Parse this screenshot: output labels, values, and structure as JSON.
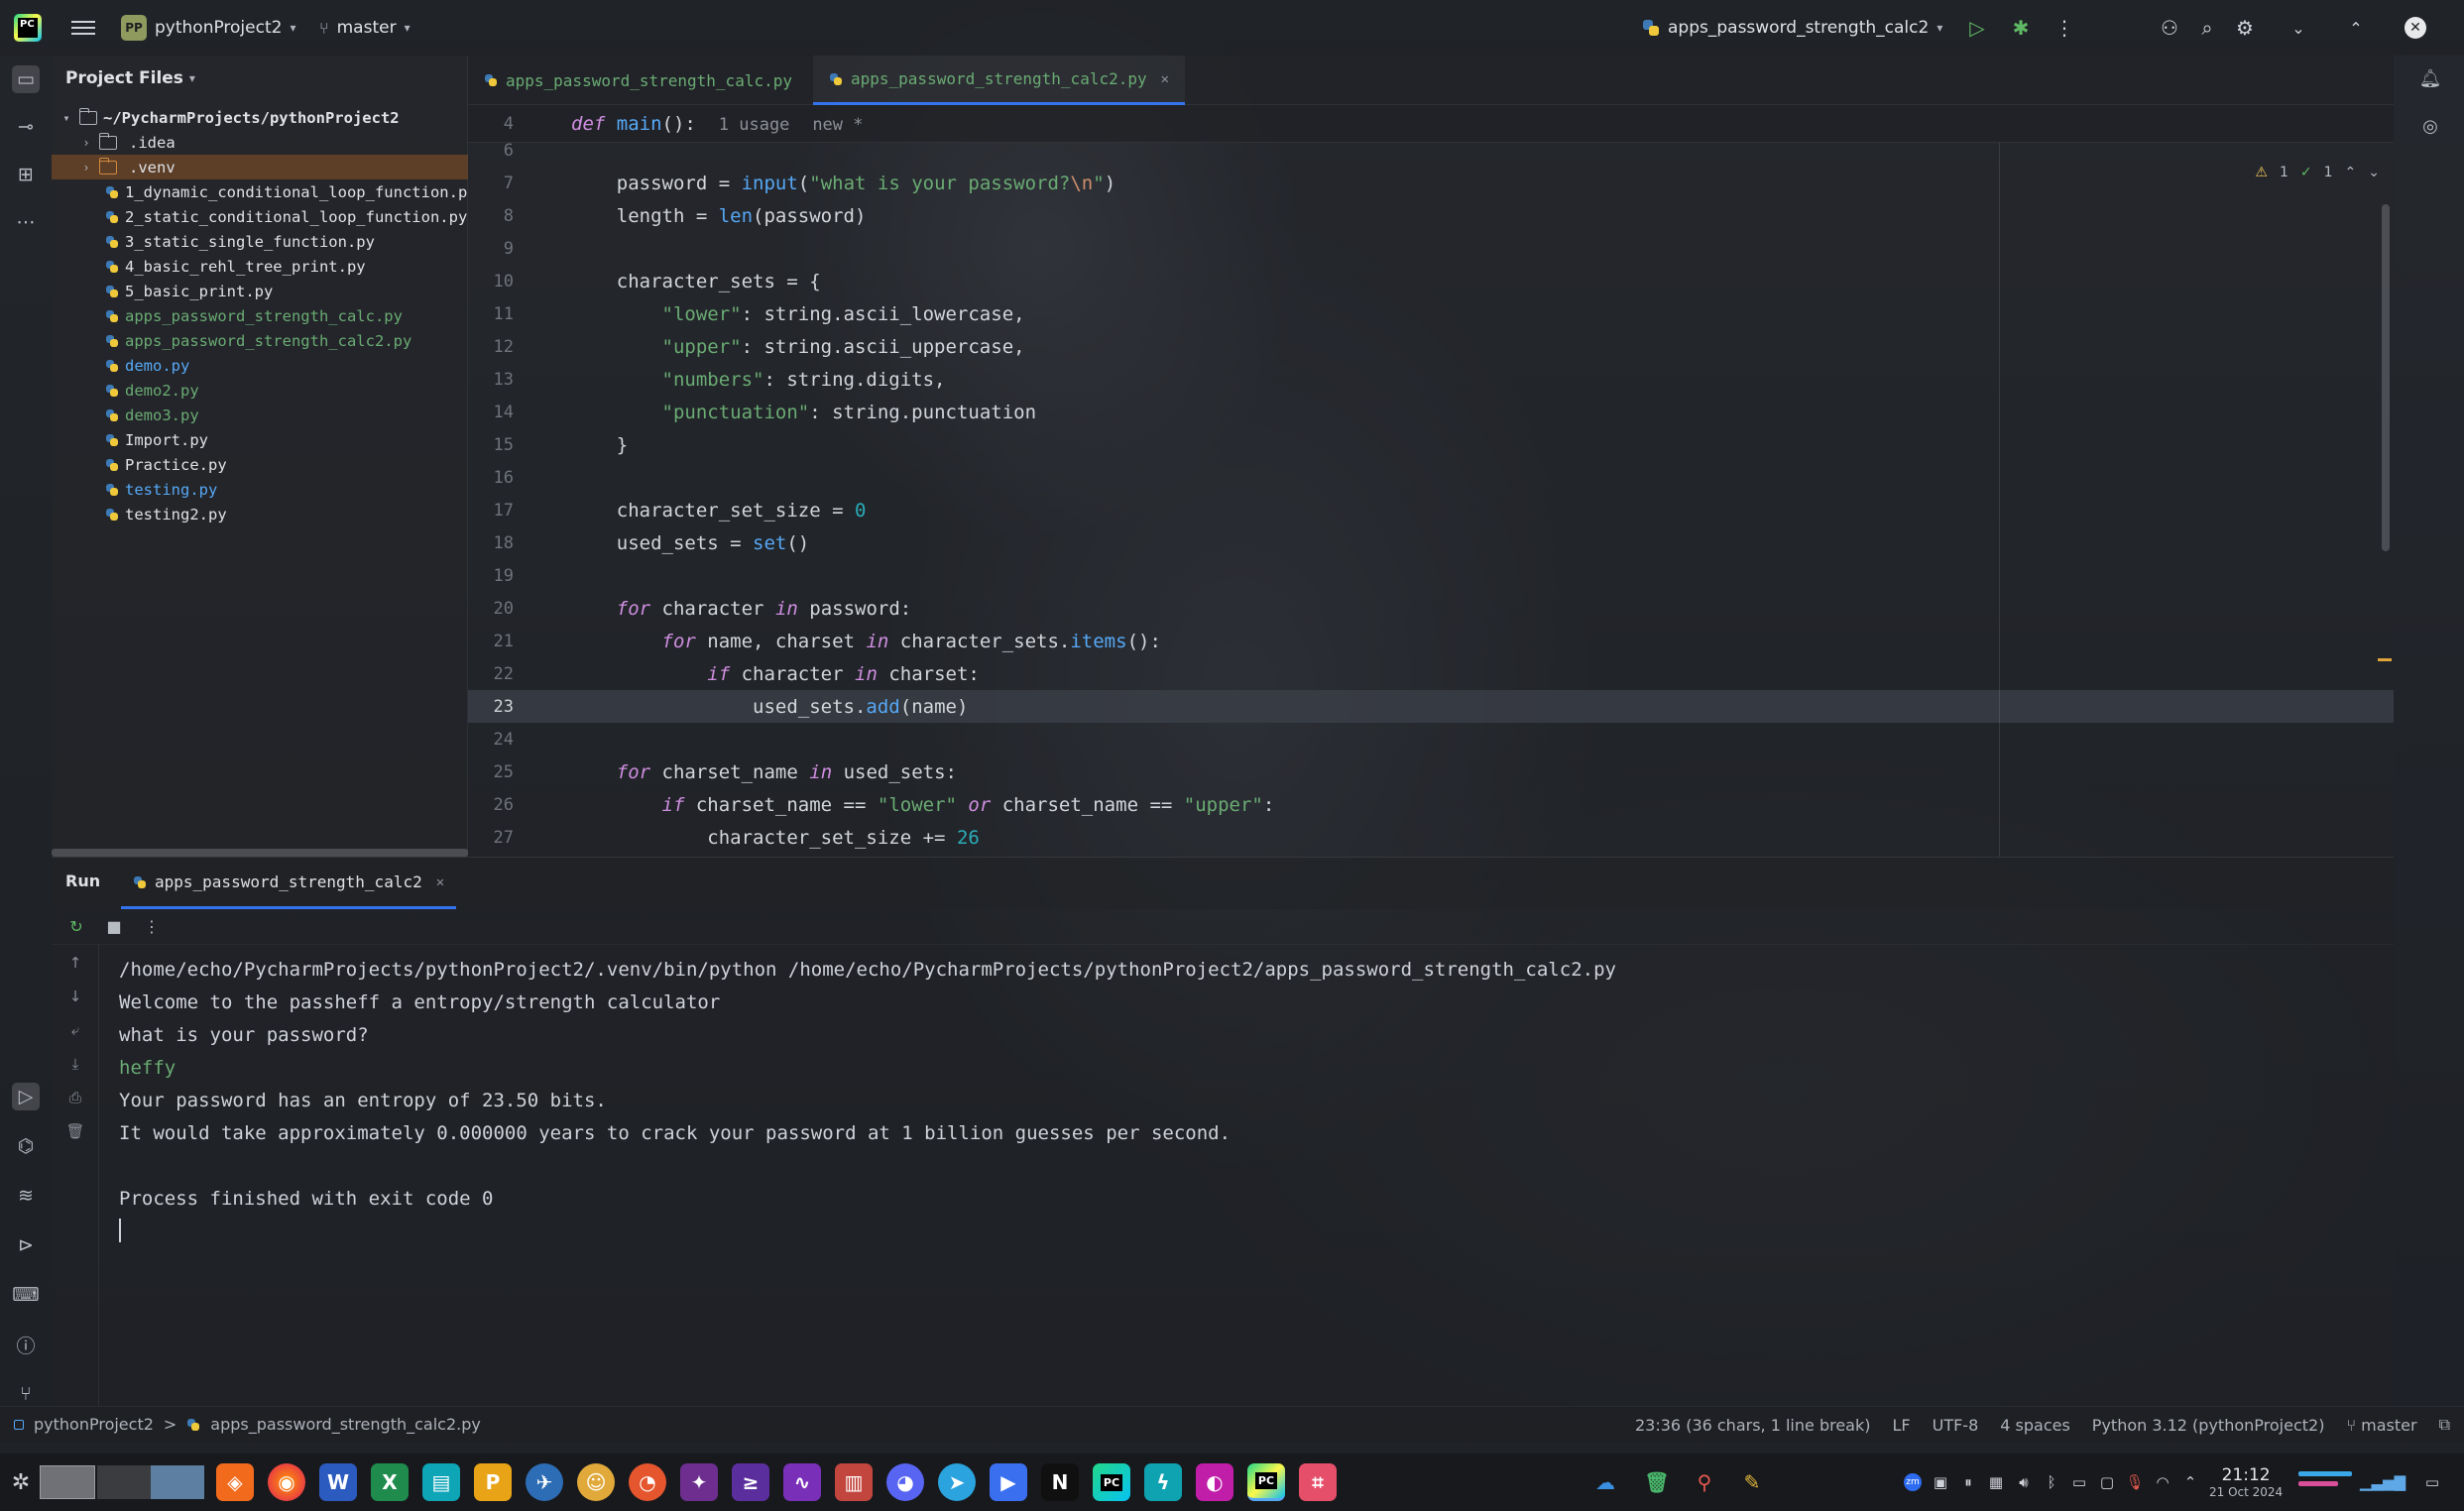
{
  "titlebar": {
    "project_badge": "PP",
    "project_name": "pythonProject2",
    "branch": "master",
    "run_config": "apps_password_strength_calc2",
    "icons": [
      "pycharm-logo",
      "hamburger-icon",
      "branch-icon",
      "run-icon",
      "debug-icon",
      "more-icon",
      "add-user-icon",
      "search-icon",
      "gear-icon",
      "chevron-down-icon",
      "maximize-icon",
      "close-icon"
    ]
  },
  "project_panel": {
    "title": "Project Files",
    "root": "~/PycharmProjects/pythonProject2",
    "items": [
      {
        "name": ".idea",
        "type": "folder",
        "color": "default"
      },
      {
        "name": ".venv",
        "type": "folder",
        "color": "orange",
        "selected": true
      },
      {
        "name": "1_dynamic_conditional_loop_function.py",
        "type": "file",
        "color": "default"
      },
      {
        "name": "2_static_conditional_loop_function.py",
        "type": "file",
        "color": "default"
      },
      {
        "name": "3_static_single_function.py",
        "type": "file",
        "color": "default"
      },
      {
        "name": "4_basic_rehl_tree_print.py",
        "type": "file",
        "color": "default"
      },
      {
        "name": "5_basic_print.py",
        "type": "file",
        "color": "default"
      },
      {
        "name": "apps_password_strength_calc.py",
        "type": "file",
        "color": "green"
      },
      {
        "name": "apps_password_strength_calc2.py",
        "type": "file",
        "color": "green"
      },
      {
        "name": "demo.py",
        "type": "file",
        "color": "blue"
      },
      {
        "name": "demo2.py",
        "type": "file",
        "color": "green"
      },
      {
        "name": "demo3.py",
        "type": "file",
        "color": "green"
      },
      {
        "name": "Import.py",
        "type": "file",
        "color": "default"
      },
      {
        "name": "Practice.py",
        "type": "file",
        "color": "default"
      },
      {
        "name": "testing.py",
        "type": "file",
        "color": "blue"
      },
      {
        "name": "testing2.py",
        "type": "file",
        "color": "default"
      }
    ]
  },
  "editor": {
    "tabs": [
      {
        "label": "apps_password_strength_calc.py",
        "active": false
      },
      {
        "label": "apps_password_strength_calc2.py",
        "active": true
      }
    ],
    "sticky": {
      "line": "4",
      "keyword": "def",
      "name": "main",
      "parens": "():",
      "usages": "1 usage",
      "status": "new *"
    },
    "inspections": {
      "warnings": "1",
      "ok": "1"
    },
    "lines": [
      {
        "n": "6",
        "tokens": []
      },
      {
        "n": "7",
        "tokens": [
          [
            "",
            "    password = "
          ],
          [
            "fn",
            "input"
          ],
          [
            "",
            "("
          ],
          [
            "str",
            "\"what is your password?"
          ],
          [
            "esc",
            "\\n"
          ],
          [
            "str",
            "\""
          ],
          [
            "",
            ")"
          ]
        ]
      },
      {
        "n": "8",
        "tokens": [
          [
            "",
            "    length = "
          ],
          [
            "fn",
            "len"
          ],
          [
            "",
            "(password)"
          ]
        ]
      },
      {
        "n": "9",
        "tokens": []
      },
      {
        "n": "10",
        "tokens": [
          [
            "",
            "    character_sets = {"
          ]
        ]
      },
      {
        "n": "11",
        "tokens": [
          [
            "",
            "        "
          ],
          [
            "str",
            "\"lower\""
          ],
          [
            "",
            ": string.ascii_lowercase,"
          ]
        ]
      },
      {
        "n": "12",
        "tokens": [
          [
            "",
            "        "
          ],
          [
            "str",
            "\"upper\""
          ],
          [
            "",
            ": string.ascii_uppercase,"
          ]
        ]
      },
      {
        "n": "13",
        "tokens": [
          [
            "",
            "        "
          ],
          [
            "str",
            "\"numbers\""
          ],
          [
            "",
            ": string.digits,"
          ]
        ]
      },
      {
        "n": "14",
        "tokens": [
          [
            "",
            "        "
          ],
          [
            "str",
            "\"punctuation\""
          ],
          [
            "",
            ": string.punctuation"
          ]
        ]
      },
      {
        "n": "15",
        "tokens": [
          [
            "",
            "    }"
          ]
        ]
      },
      {
        "n": "16",
        "tokens": []
      },
      {
        "n": "17",
        "tokens": [
          [
            "",
            "    character_set_size = "
          ],
          [
            "num",
            "0"
          ]
        ]
      },
      {
        "n": "18",
        "tokens": [
          [
            "",
            "    used_sets = "
          ],
          [
            "fn",
            "set"
          ],
          [
            "",
            "()"
          ]
        ]
      },
      {
        "n": "19",
        "tokens": []
      },
      {
        "n": "20",
        "tokens": [
          [
            "",
            "    "
          ],
          [
            "kw",
            "for"
          ],
          [
            "",
            " character "
          ],
          [
            "kw",
            "in"
          ],
          [
            "",
            " password:"
          ]
        ]
      },
      {
        "n": "21",
        "tokens": [
          [
            "",
            "        "
          ],
          [
            "kw",
            "for"
          ],
          [
            "",
            " name, charset "
          ],
          [
            "kw",
            "in"
          ],
          [
            "",
            " character_sets."
          ],
          [
            "fn",
            "items"
          ],
          [
            "",
            "():"
          ]
        ]
      },
      {
        "n": "22",
        "tokens": [
          [
            "",
            "            "
          ],
          [
            "kw",
            "if"
          ],
          [
            "",
            " character "
          ],
          [
            "kw",
            "in"
          ],
          [
            "",
            " charset:"
          ]
        ]
      },
      {
        "n": "23",
        "tokens": [
          [
            "",
            "                used_sets."
          ],
          [
            "fn",
            "add"
          ],
          [
            "",
            "(name)"
          ]
        ],
        "current": true
      },
      {
        "n": "24",
        "tokens": []
      },
      {
        "n": "25",
        "tokens": [
          [
            "",
            "    "
          ],
          [
            "kw",
            "for"
          ],
          [
            "",
            " charset_name "
          ],
          [
            "kw",
            "in"
          ],
          [
            "",
            " used_sets:"
          ]
        ]
      },
      {
        "n": "26",
        "tokens": [
          [
            "",
            "        "
          ],
          [
            "kw",
            "if"
          ],
          [
            "",
            " charset_name == "
          ],
          [
            "str",
            "\"lower\""
          ],
          [
            "",
            " "
          ],
          [
            "kw",
            "or"
          ],
          [
            "",
            " charset_name == "
          ],
          [
            "str",
            "\"upper\""
          ],
          [
            "",
            ":"
          ]
        ]
      },
      {
        "n": "27",
        "tokens": [
          [
            "",
            "            character_set_size += "
          ],
          [
            "num",
            "26"
          ]
        ]
      }
    ]
  },
  "run": {
    "title": "Run",
    "tab": "apps_password_strength_calc2",
    "console": [
      {
        "text": "/home/echo/PycharmProjects/pythonProject2/.venv/bin/python /home/echo/PycharmProjects/pythonProject2/apps_password_strength_calc2.py",
        "kind": "cmd"
      },
      {
        "text": "Welcome to the passheff a entropy/strength calculator",
        "kind": "out"
      },
      {
        "text": "what is your password?",
        "kind": "out"
      },
      {
        "text": "heffy",
        "kind": "input"
      },
      {
        "text": "Your password has an entropy of 23.50 bits.",
        "kind": "out"
      },
      {
        "text": "It would take approximately 0.000000 years to crack your password at 1 billion guesses per second.",
        "kind": "out"
      },
      {
        "text": "",
        "kind": "out"
      },
      {
        "text": "Process finished with exit code 0",
        "kind": "out"
      }
    ]
  },
  "statusbar": {
    "breadcrumb_project": "pythonProject2",
    "breadcrumb_sep": ">",
    "breadcrumb_file": "apps_password_strength_calc2.py",
    "position": "23:36 (36 chars, 1 line break)",
    "line_sep": "LF",
    "encoding": "UTF-8",
    "indent": "4 spaces",
    "interpreter": "Python 3.12 (pythonProject2)",
    "branch": "master"
  },
  "taskbar": {
    "clock_time": "21:12",
    "clock_date": "21 Oct 2024",
    "tray_badge": "zm"
  },
  "colors": {
    "accent": "#3574f0",
    "keyword": "#cf8ee0",
    "function": "#56a8f5",
    "string": "#6aab73",
    "number": "#2aacb8",
    "vcs_added": "#6aab73",
    "vcs_modified": "#56a8f5",
    "selection": "#704828"
  }
}
